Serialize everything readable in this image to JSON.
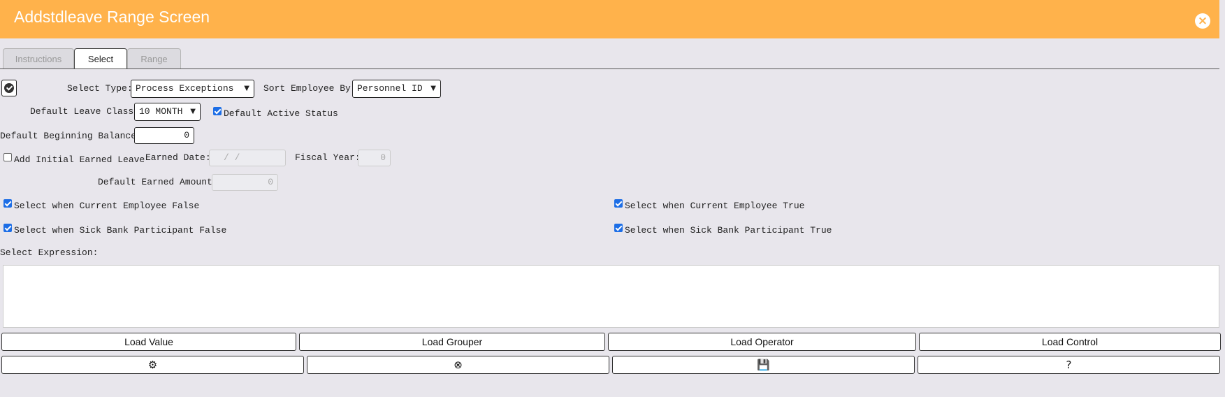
{
  "window": {
    "title": "Addstdleave Range Screen",
    "close_icon": "×"
  },
  "tabs": [
    {
      "label": "Instructions",
      "active": false
    },
    {
      "label": "Select",
      "active": true
    },
    {
      "label": "Range",
      "active": false
    }
  ],
  "form": {
    "select_type": {
      "label": "Select Type:",
      "value": "Process Exceptions"
    },
    "sort_employee_by": {
      "label": "Sort Employee By:",
      "value": "Personnel ID"
    },
    "default_leave_class": {
      "label": "Default Leave Class:",
      "value": "10 MONTH"
    },
    "default_active_status": {
      "label": "Default Active Status",
      "checked": true
    },
    "default_beginning_balance": {
      "label": "Default Beginning Balance:",
      "value": "0"
    },
    "add_initial_earned_leave": {
      "label": "Add Initial Earned Leave",
      "checked": false
    },
    "earned_date": {
      "label": "Earned Date:",
      "value": "/  /"
    },
    "fiscal_year": {
      "label": "Fiscal Year:",
      "value": "0"
    },
    "default_earned_amount": {
      "label": "Default Earned Amount:",
      "value": "0"
    },
    "current_employee_false": {
      "label": "Select when Current Employee False",
      "checked": true
    },
    "current_employee_true": {
      "label": "Select when Current Employee True",
      "checked": true
    },
    "sick_bank_false": {
      "label": "Select when Sick Bank Participant False",
      "checked": true
    },
    "sick_bank_true": {
      "label": "Select when Sick Bank Participant True",
      "checked": true
    },
    "select_expression": {
      "label": "Select Expression:",
      "value": ""
    }
  },
  "buttons": {
    "load_value": "Load Value",
    "load_grouper": "Load Grouper",
    "load_operator": "Load Operator",
    "load_control": "Load Control",
    "settings_icon": "⚙",
    "cancel_icon": "⊗",
    "save_icon": "💾",
    "help_icon": "?"
  },
  "colors": {
    "header": "#ffb24b",
    "checkbox": "#1d6ee6"
  }
}
